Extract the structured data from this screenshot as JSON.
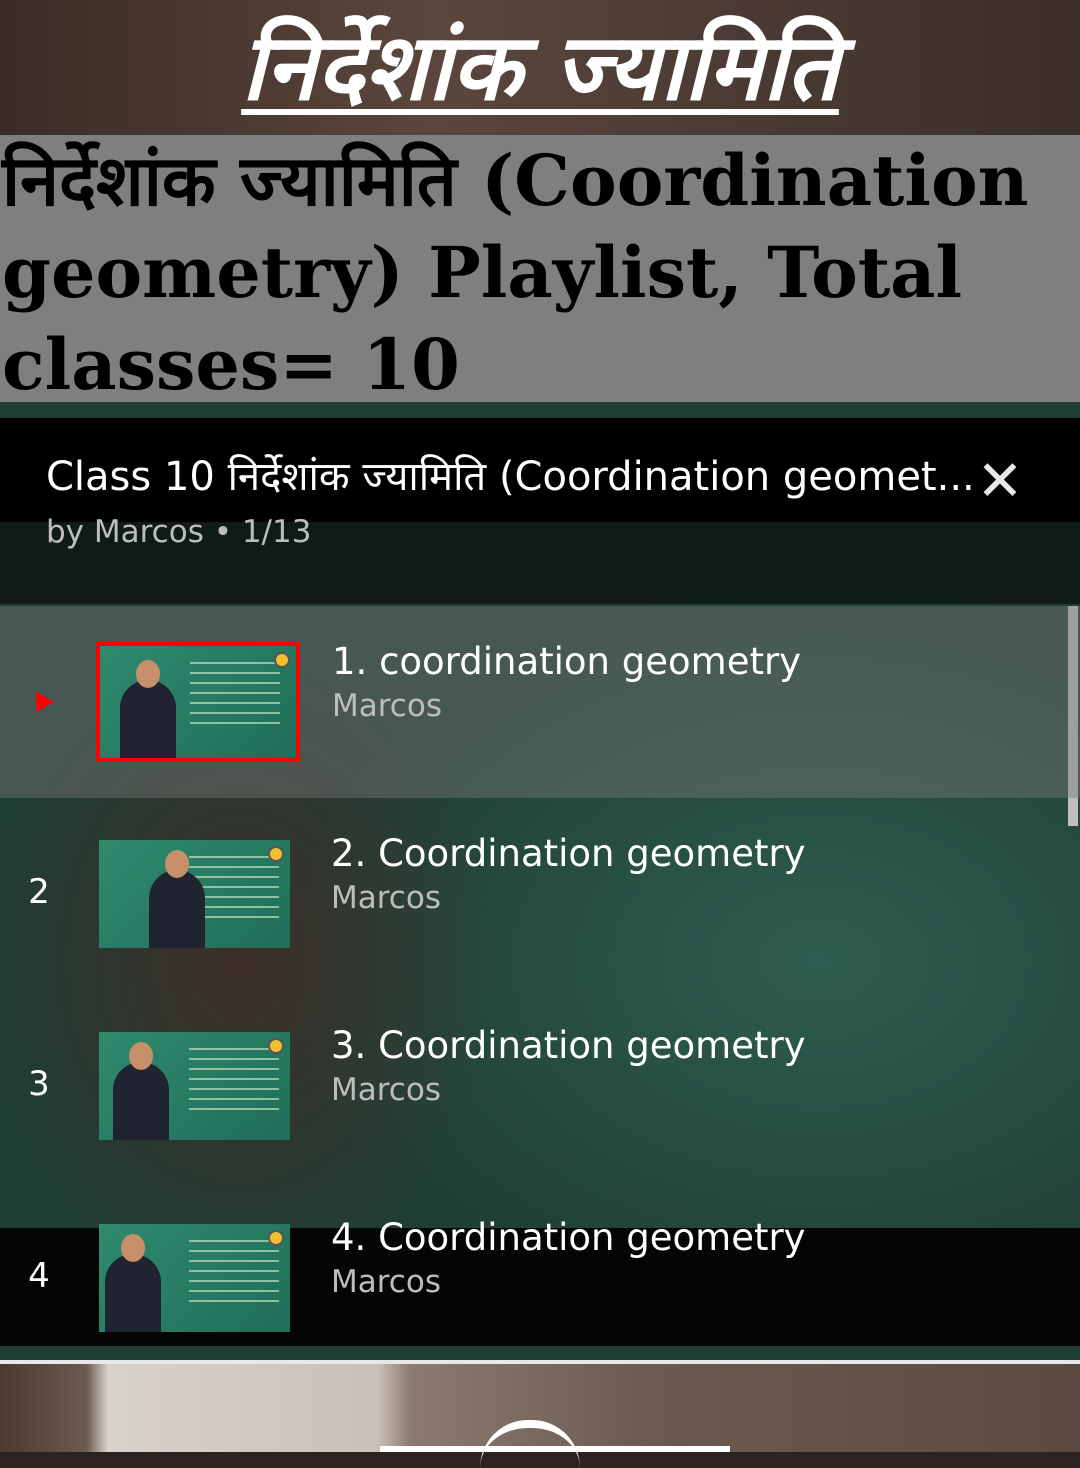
{
  "video_banner": {
    "title": "निर्देशांक ज्यामिति"
  },
  "description": {
    "lines": [
      "निर्देशांक ज्यामिति (Coordination",
      "geometry) Playlist, Total",
      "classes= 10"
    ]
  },
  "playlist": {
    "title": "Class 10 निर्देशांक ज्यामिति (Coordination geomet...",
    "subtitle": "by Marcos • 1/13",
    "close_icon": "close-icon",
    "items": [
      {
        "index": "",
        "title": "1. coordination geometry",
        "author": "Marcos",
        "playing": true
      },
      {
        "index": "2",
        "title": "2. Coordination geometry",
        "author": "Marcos",
        "playing": false
      },
      {
        "index": "3",
        "title": "3. Coordination geometry",
        "author": "Marcos",
        "playing": false
      },
      {
        "index": "4",
        "title": "4. Coordination geometry",
        "author": "Marcos",
        "playing": false
      }
    ]
  },
  "colors": {
    "accent": "#ff0000",
    "panel_bg": "#000000",
    "description_bg": "#7f7f7f"
  }
}
